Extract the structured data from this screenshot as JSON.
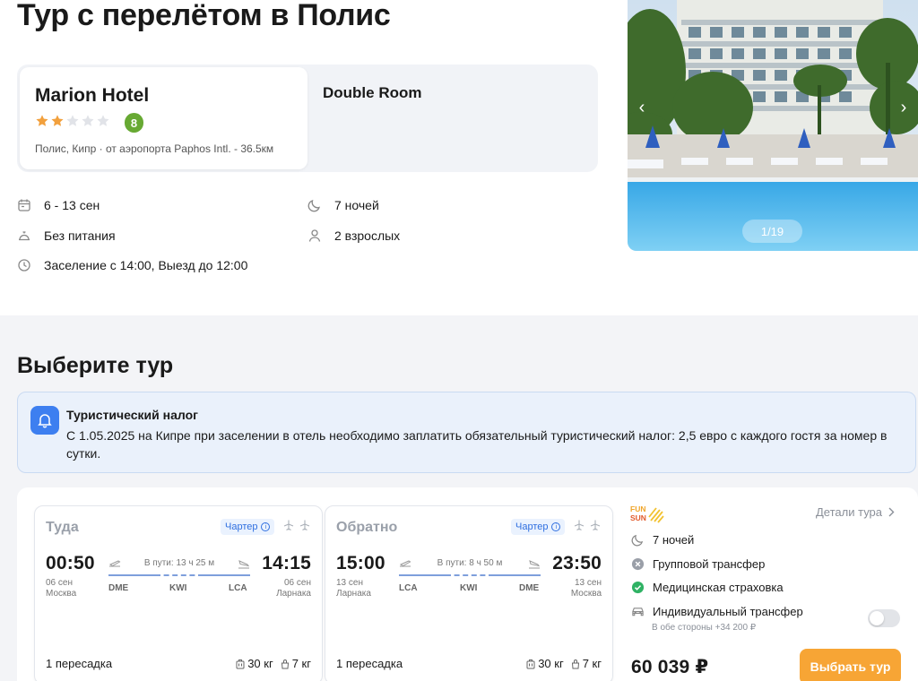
{
  "page_title": "Тур с перелётом в Полис",
  "hotel": {
    "name": "Marion Hotel",
    "stars_filled": 2,
    "stars_total": 5,
    "rating": "8",
    "location": "Полис, Кипр  · от аэропорта Paphos Intl. - 36.5км",
    "room_type": "Double Room"
  },
  "trip_info": {
    "dates": "6 - 13 сен",
    "nights": "7 ночей",
    "meal": "Без питания",
    "guests": "2 взрослых",
    "checkin": "Заселение с 14:00, Выезд до 12:00"
  },
  "gallery": {
    "counter": "1/19",
    "prev": "‹",
    "next": "›"
  },
  "section_title": "Выберите тур",
  "notice": {
    "title": "Туристический налог",
    "text": "С 1.05.2025 на Кипре при заселении в отель необходимо заплатить обязательный туристический налог: 2,5 евро с каждого гостя за номер в сутки."
  },
  "flights": [
    {
      "direction": "Туда",
      "badge": "Чартер",
      "dep_time": "00:50",
      "dep_date": "06 сен",
      "dep_city": "Москва",
      "duration": "В пути: 13 ч 25 м",
      "codes": [
        "DME",
        "KWI",
        "LCA"
      ],
      "arr_time": "14:15",
      "arr_date": "06 сен",
      "arr_city": "Ларнака",
      "transfers": "1 пересадка",
      "baggage": "30 кг",
      "hand_luggage": "7 кг"
    },
    {
      "direction": "Обратно",
      "badge": "Чартер",
      "dep_time": "15:00",
      "dep_date": "13 сен",
      "dep_city": "Ларнака",
      "duration": "В пути: 8 ч 50 м",
      "codes": [
        "LCA",
        "KWI",
        "DME"
      ],
      "arr_time": "23:50",
      "arr_date": "13 сен",
      "arr_city": "Москва",
      "transfers": "1 пересадка",
      "baggage": "30 кг",
      "hand_luggage": "7 кг"
    }
  ],
  "offer": {
    "operator_logo_top": "FUN",
    "operator_logo_bottom": "SUN",
    "details_link": "Детали тура",
    "nights": "7 ночей",
    "group_transfer": "Групповой трансфер",
    "insurance": "Медицинская страховка",
    "individual_transfer": "Индивидуальный трансфер",
    "individual_transfer_note": "В обе стороны +34 200 ₽",
    "individual_transfer_on": false,
    "price": "60 039 ₽",
    "select_button": "Выбрать тур"
  },
  "colors": {
    "accent_orange": "#f7a535",
    "rating_green": "#67a933",
    "star_orange": "#f2a03d",
    "link_blue": "#2f6fe0",
    "check_green": "#2fb264"
  }
}
